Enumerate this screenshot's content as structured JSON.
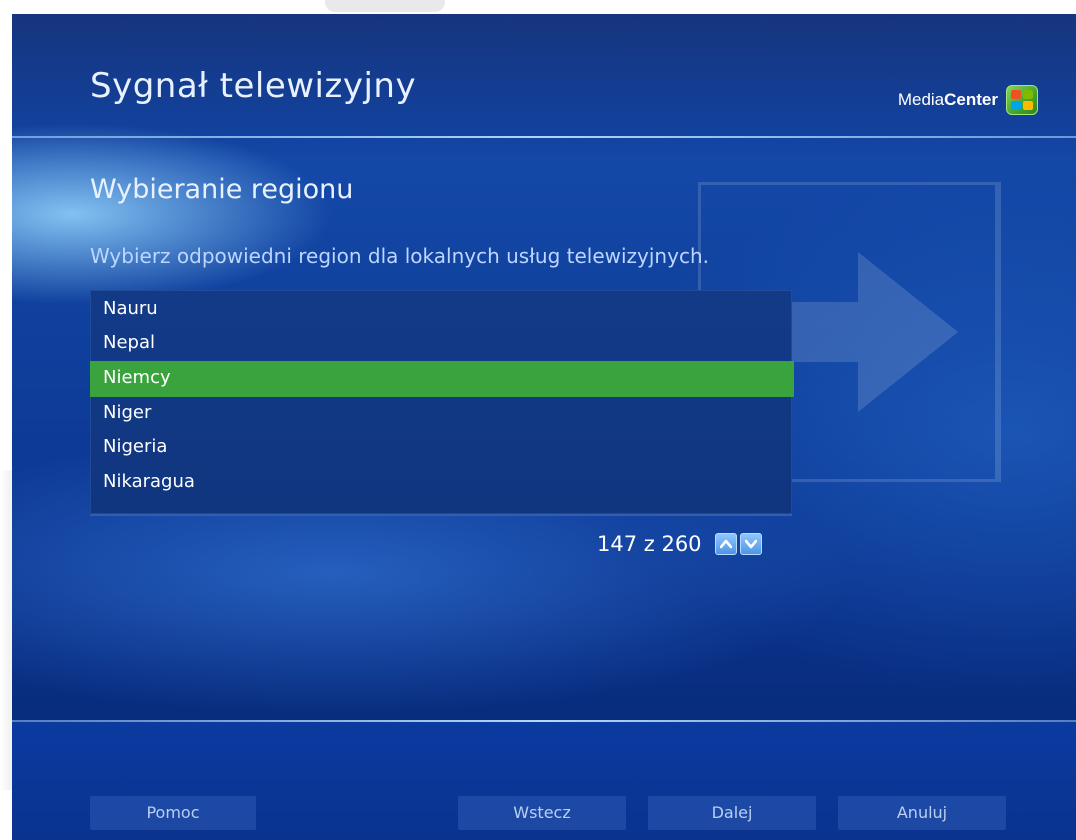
{
  "header": {
    "title": "Sygnał telewizyjny",
    "brand_prefix": "Media",
    "brand_bold": "Center",
    "brand_icon": "windows-logo-icon"
  },
  "section": {
    "title": "Wybieranie regionu",
    "instruction": "Wybierz odpowiedni region dla lokalnych usług telewizyjnych."
  },
  "region_list": {
    "items": [
      {
        "label": "Nauru",
        "selected": false
      },
      {
        "label": "Nepal",
        "selected": false
      },
      {
        "label": "Niemcy",
        "selected": true
      },
      {
        "label": "Niger",
        "selected": false
      },
      {
        "label": "Nigeria",
        "selected": false
      },
      {
        "label": "Nikaragua",
        "selected": false
      }
    ],
    "selection_color": "#3aa33d"
  },
  "pager": {
    "text": "147 z 260",
    "up_icon": "chevron-up-icon",
    "down_icon": "chevron-down-icon"
  },
  "footer": {
    "help_label": "Pomoc",
    "back_label": "Wstecz",
    "next_label": "Dalej",
    "cancel_label": "Anuluj"
  },
  "colors": {
    "background_primary": "#0f3f9c",
    "accent_green": "#3aa33d",
    "text_light": "#e8f2ff"
  }
}
